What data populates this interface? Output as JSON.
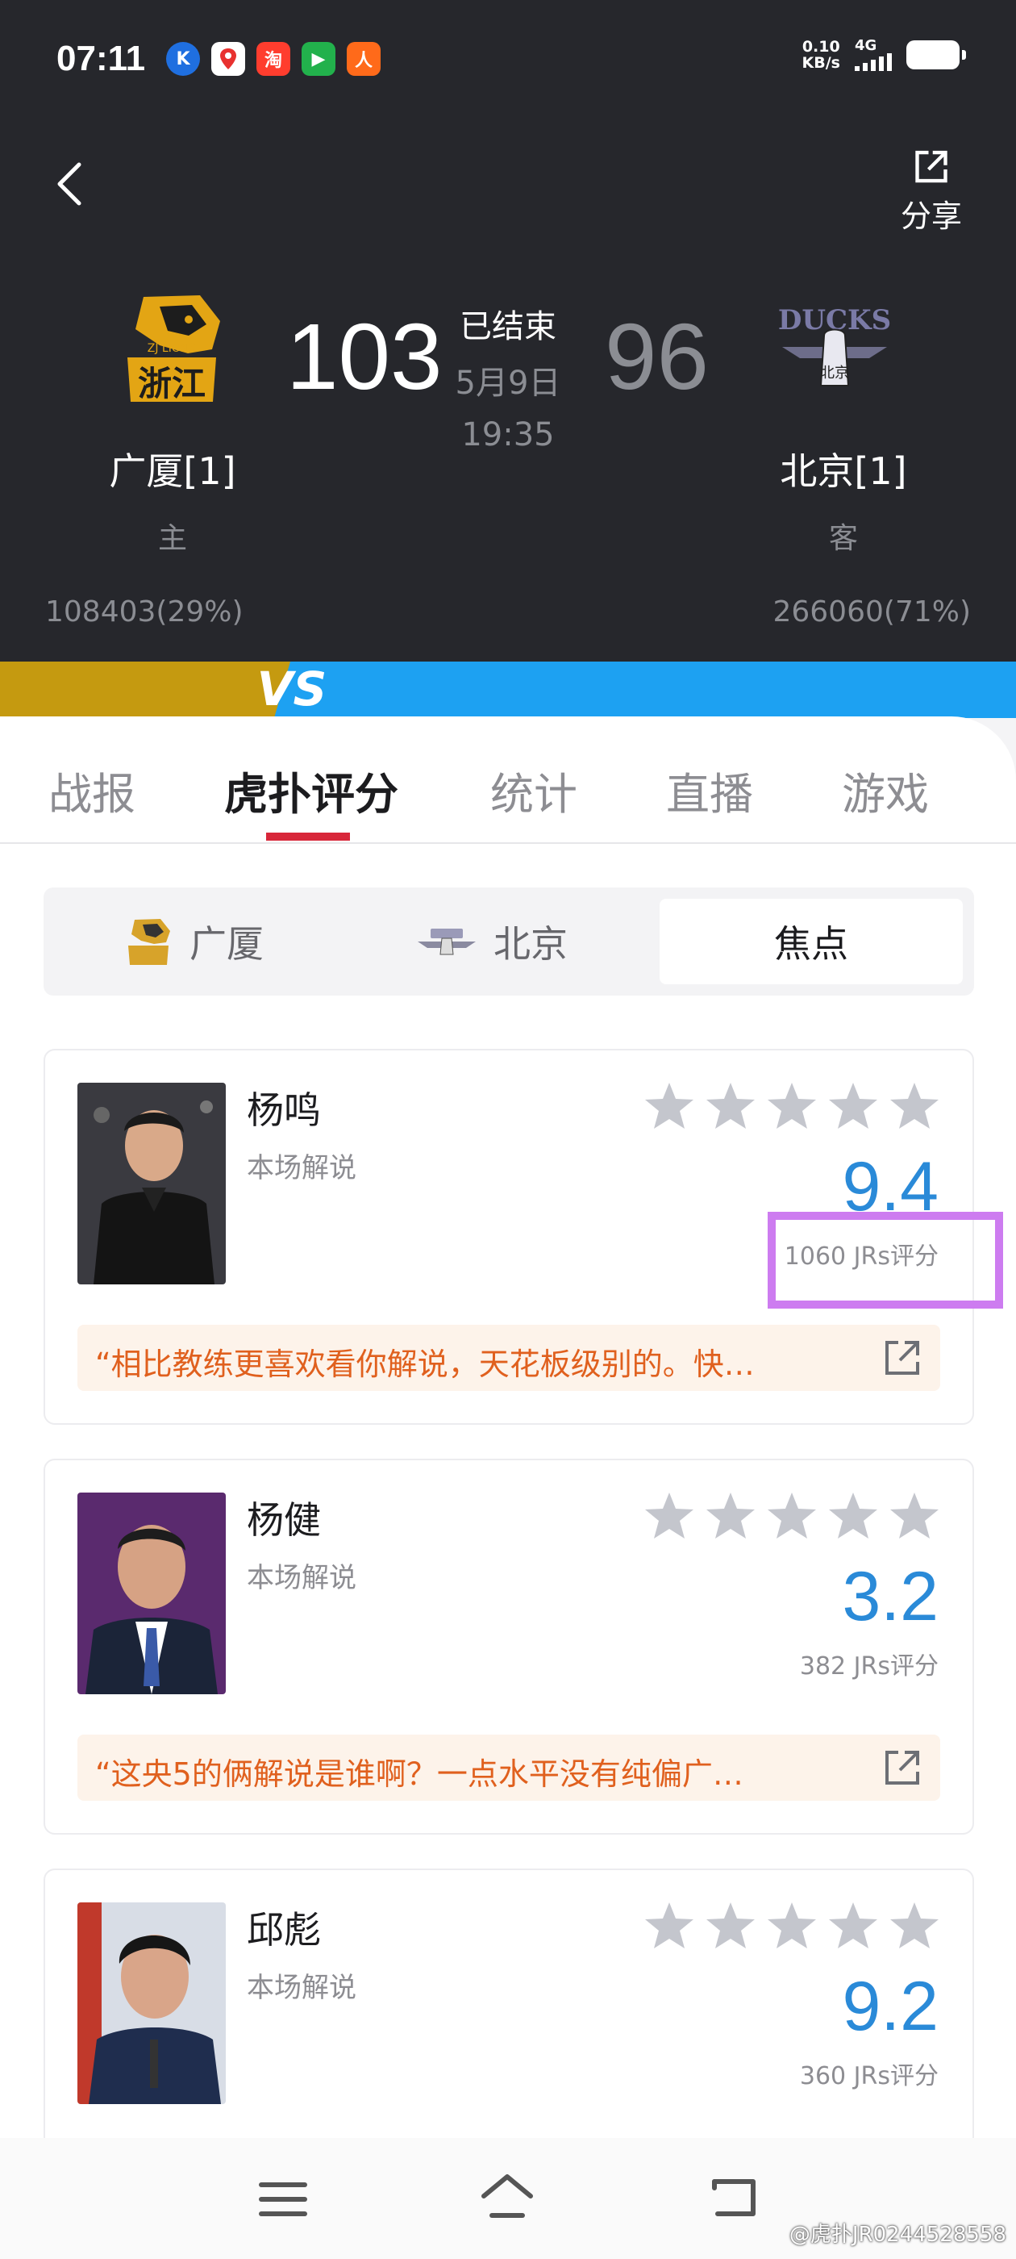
{
  "status_bar": {
    "time": "07:11",
    "net_speed_value": "0.10",
    "net_speed_unit": "KB/s",
    "network_type": "4G",
    "apps": [
      "K",
      "",
      "淘",
      "▶",
      "人"
    ]
  },
  "header": {
    "share_label": "分享",
    "game_status": "已结束",
    "game_date": "5月9日",
    "game_time": "19:35",
    "home": {
      "score": "103",
      "name": "广厦[1]",
      "role": "主",
      "votes": "108403(29%)",
      "logo_text": "浙江",
      "logo_sub": "ZJ LIONS"
    },
    "away": {
      "score": "96",
      "name": "北京[1]",
      "role": "客",
      "votes": "266060(71%)",
      "logo_text": "DUCKS",
      "logo_sub": "北京"
    },
    "vs_label": "VS"
  },
  "tabs": [
    {
      "label": "战报",
      "active": false
    },
    {
      "label": "虎扑评分",
      "active": true
    },
    {
      "label": "统计",
      "active": false
    },
    {
      "label": "直播",
      "active": false
    },
    {
      "label": "游戏",
      "active": false
    }
  ],
  "segment": {
    "items": [
      {
        "label": "广厦",
        "active": false
      },
      {
        "label": "北京",
        "active": false
      },
      {
        "label": "焦点",
        "active": true
      }
    ]
  },
  "cards": [
    {
      "name": "杨鸣",
      "role": "本场解说",
      "rating": "9.4",
      "count": "1060 JRs评分",
      "comment": "“相比教练更喜欢看你解说，天花板级别的。快…",
      "stars_filled": 0
    },
    {
      "name": "杨健",
      "role": "本场解说",
      "rating": "3.2",
      "count": "382 JRs评分",
      "comment": "“这央5的俩解说是谁啊？一点水平没有纯偏广…",
      "stars_filled": 0
    },
    {
      "name": "邱彪",
      "role": "本场解说",
      "rating": "9.2",
      "count": "360 JRs评分",
      "comment": "",
      "stars_filled": 0
    }
  ],
  "watermark": "@虎扑JR0244528558",
  "colors": {
    "header_bg": "#26272c",
    "accent_red": "#d8273a",
    "rating_blue": "#2a8ad8",
    "comment_orange": "#e0601e",
    "comment_bg": "#fdf3ea",
    "home_bar": "#c59a10",
    "away_bar": "#1da1f2",
    "highlight": "#cd7cf0"
  }
}
